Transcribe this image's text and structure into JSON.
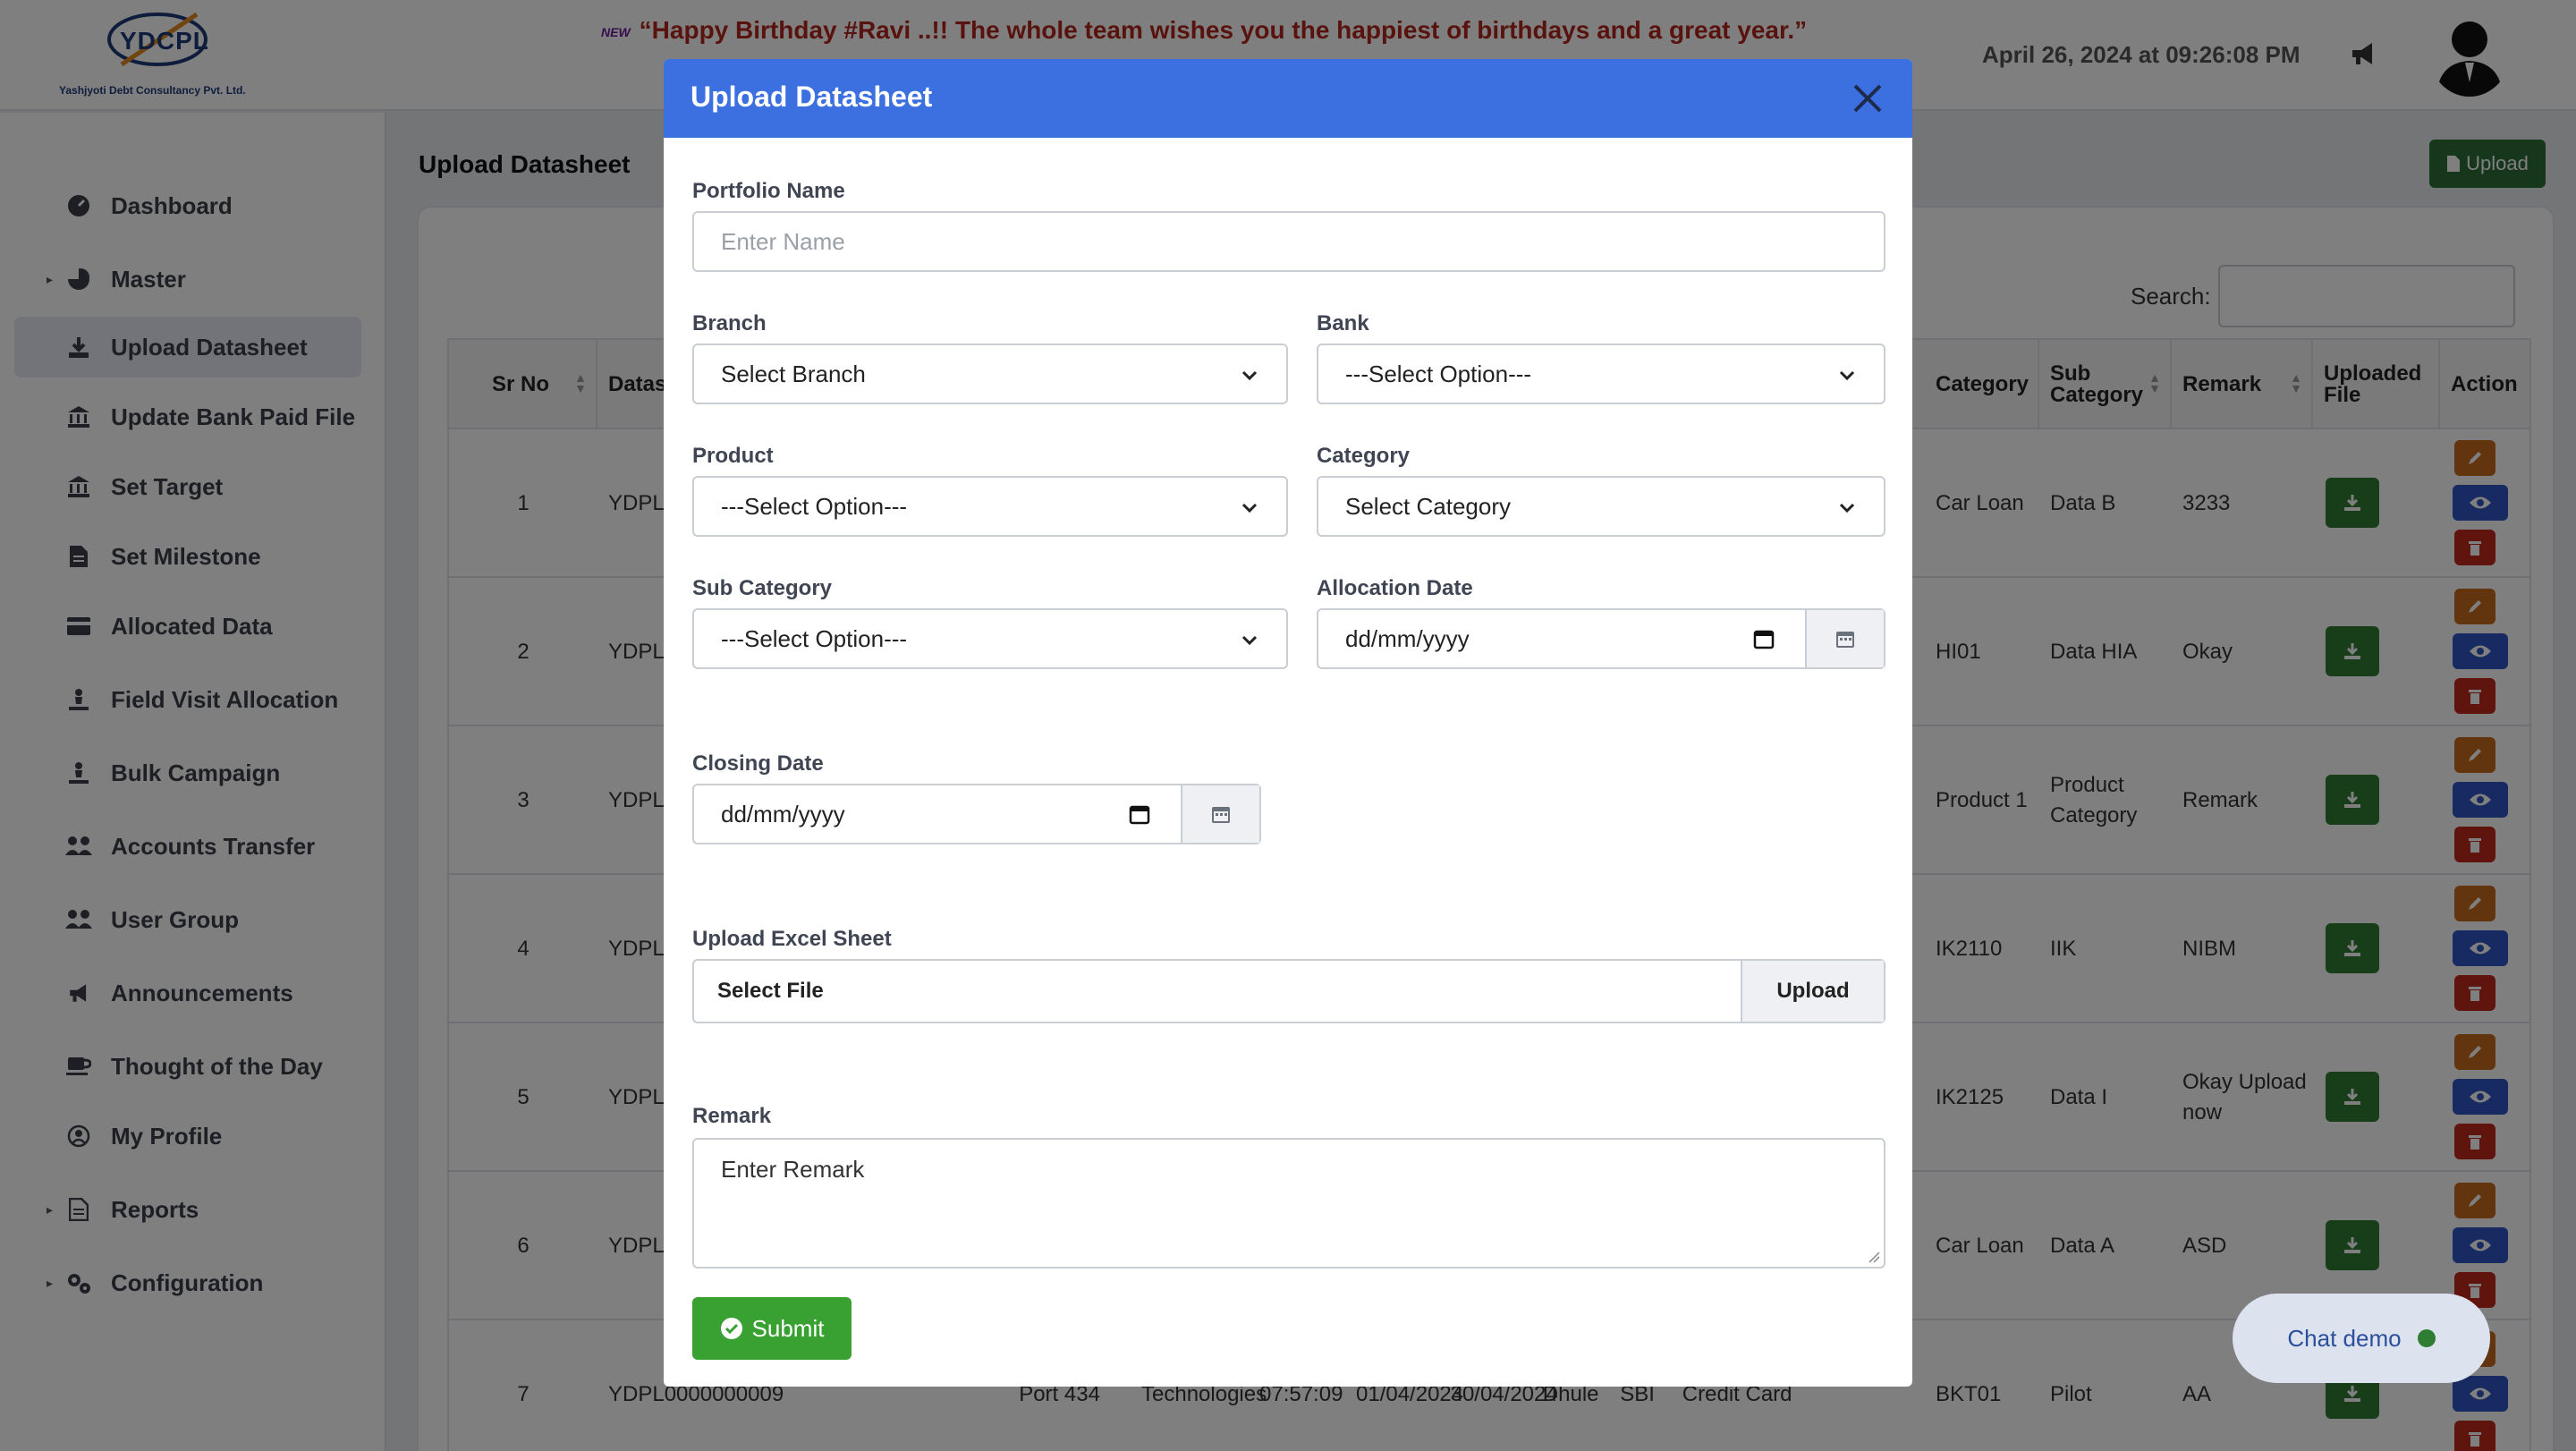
{
  "header": {
    "logo_text": "YDCPL",
    "logo_subtitle": "Yashjyoti Debt Consultancy Pvt. Ltd.",
    "new_badge": "NEW",
    "announcement": "“Happy Birthday #Ravi ..!! The whole team wishes you the happiest of birthdays and a great year.”",
    "datetime": "April 26, 2024 at 09:26:08 PM",
    "icons": [
      "megaphone-icon",
      "avatar"
    ]
  },
  "sidebar": {
    "items": [
      {
        "label": "Dashboard",
        "icon": "dashboard-icon",
        "caret": ""
      },
      {
        "label": "Master",
        "icon": "pie-chart-icon",
        "caret": "▸"
      },
      {
        "label": "Upload Datasheet",
        "icon": "download-icon",
        "caret": "",
        "active": true
      },
      {
        "label": "Update Bank Paid File",
        "icon": "bank-icon",
        "caret": ""
      },
      {
        "label": "Set Target",
        "icon": "bank-icon",
        "caret": ""
      },
      {
        "label": "Set Milestone",
        "icon": "file-icon",
        "caret": ""
      },
      {
        "label": "Allocated Data",
        "icon": "card-icon",
        "caret": ""
      },
      {
        "label": "Field Visit Allocation",
        "icon": "person-icon",
        "caret": ""
      },
      {
        "label": "Bulk Campaign",
        "icon": "person-icon",
        "caret": ""
      },
      {
        "label": "Accounts Transfer",
        "icon": "users-icon",
        "caret": ""
      },
      {
        "label": "User Group",
        "icon": "users-icon",
        "caret": ""
      },
      {
        "label": "Announcements",
        "icon": "megaphone-icon",
        "caret": ""
      },
      {
        "label": "Thought of the Day",
        "icon": "cup-icon",
        "caret": ""
      },
      {
        "label": "My Profile",
        "icon": "user-circle-icon",
        "caret": ""
      },
      {
        "label": "Reports",
        "icon": "report-icon",
        "caret": "▸"
      },
      {
        "label": "Configuration",
        "icon": "gears-icon",
        "caret": "▸"
      }
    ]
  },
  "page": {
    "title": "Upload Datasheet",
    "upload_button": "Upload",
    "search_label": "Search:"
  },
  "table": {
    "headers": {
      "sr_no": "Sr No",
      "datasheet": "Datasl",
      "category": "Category",
      "sub_category": "Sub Category",
      "remark": "Remark",
      "uploaded_file": "Uploaded File",
      "action": "Action"
    },
    "rows": [
      {
        "sr": "1",
        "ds": "YDPLC",
        "category": "Car Loan",
        "sub": "Data B",
        "remark": "3233"
      },
      {
        "sr": "2",
        "ds": "YDPLC",
        "category": "HI01",
        "sub": "Data HIA",
        "remark": "Okay"
      },
      {
        "sr": "3",
        "ds": "YDPLC",
        "category": "Product 1",
        "sub": "Product Category",
        "remark": "Remark"
      },
      {
        "sr": "4",
        "ds": "YDPLC",
        "category": "IK2110",
        "sub": "IIK",
        "remark": "NIBM"
      },
      {
        "sr": "5",
        "ds": "YDPLC",
        "category": "IK2125",
        "sub": "Data I",
        "remark": "Okay Upload now"
      },
      {
        "sr": "6",
        "ds": "YDPLC",
        "category": "Car Loan",
        "sub": "Data A",
        "remark": "ASD"
      },
      {
        "sr": "7",
        "ds": "YDPL0000000009",
        "category": "BKT01",
        "sub": "Pilot",
        "remark": "AA"
      }
    ],
    "row7_extra": {
      "portfolio": "Port 434",
      "branch": "Technologies",
      "time": "07:57:09",
      "alloc": "01/04/2024",
      "closing": "30/04/2024",
      "product": "Dhule",
      "bank": "SBI",
      "type": "Credit Card"
    }
  },
  "chat": {
    "label": "Chat demo"
  },
  "modal": {
    "title": "Upload Datasheet",
    "portfolio_name": {
      "label": "Portfolio Name",
      "placeholder": "Enter Name"
    },
    "branch": {
      "label": "Branch",
      "value": "Select Branch"
    },
    "bank": {
      "label": "Bank",
      "value": "---Select Option---"
    },
    "product": {
      "label": "Product",
      "value": "---Select Option---"
    },
    "category": {
      "label": "Category",
      "value": "Select Category"
    },
    "sub_category": {
      "label": "Sub Category",
      "value": "---Select Option---"
    },
    "allocation_date": {
      "label": "Allocation Date",
      "value": "dd/mm/yyyy"
    },
    "closing_date": {
      "label": "Closing Date",
      "value": "dd/mm/yyyy"
    },
    "upload_excel": {
      "label": "Upload Excel Sheet",
      "file_label": "Select File",
      "button": "Upload"
    },
    "remark": {
      "label": "Remark",
      "placeholder": "Enter Remark"
    },
    "submit": "Submit"
  },
  "colors": {
    "modal_header": "#3c6fe0",
    "submit": "#38a132",
    "announcement": "#b3261e"
  }
}
